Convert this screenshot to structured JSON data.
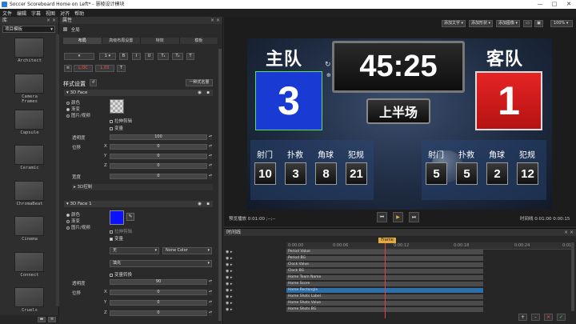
{
  "window": {
    "title": "Soccer Scoreboard Home on Left* - 慧棱设计模块"
  },
  "menu": [
    "文件",
    "编辑",
    "字幕",
    "视图",
    "对齐",
    "帮助"
  ],
  "library": {
    "panel_title": "库",
    "dropdown": "项目模板",
    "items": [
      "Architect",
      "Camera Frames",
      "Capsule",
      "Ceramic",
      "ChromaBeat",
      "Cinema",
      "Connect",
      "Cruels"
    ]
  },
  "properties": {
    "panel_title": "属性",
    "object_name": "全局",
    "tabs": [
      "布局",
      "高级布局设置",
      "特效",
      "模板"
    ],
    "text_tools": [
      "B",
      "I",
      "U",
      "T₁",
      "T₂",
      "T"
    ],
    "color_labels": [
      "L.OC",
      "L.03"
    ],
    "style_title": "样式设置",
    "style_dropdown": "一种式名量",
    "face1": {
      "title": "3D Face",
      "fill_options": [
        "颜色",
        "渐变",
        "图片/视频"
      ],
      "stretch": "拉伸剪辑",
      "vary": "变量",
      "opacity_label": "透明度",
      "opacity_value": "100",
      "pos_label": "位移",
      "x": "0",
      "y": "0",
      "z": "0",
      "width_label": "宽度",
      "width_value": "0",
      "control_3d": "3D控制"
    },
    "face2": {
      "title": "3D Face 1",
      "fill_options": [
        "颜色",
        "渐变",
        "图片/视频"
      ],
      "stretch": "拉伸剪辑",
      "vary": "变量",
      "dd1": "无",
      "dd2": "None Color",
      "dd3": "填充",
      "vary2": "变量转换",
      "opacity_label": "透明度",
      "opacity_value": "90",
      "pos_label": "位移",
      "x": "0",
      "y": "0",
      "z": "0"
    }
  },
  "preview": {
    "toolbar": [
      "添加文字 ▾",
      "添加形状 ▾",
      "添加图像 ▾"
    ],
    "zoom": "100%",
    "left_time_label": "预览播放",
    "left_time": "0:01:00 ;--;--",
    "right_time_label": "时间线",
    "right_time": "0:01:00 0:00:15",
    "controls": [
      "⏮",
      "▶",
      "⏭"
    ]
  },
  "scoreboard": {
    "home_label": "主队",
    "away_label": "客队",
    "home_score": "3",
    "away_score": "1",
    "clock": "45:25",
    "period": "上半场",
    "stat_labels": [
      "射门",
      "扑救",
      "角球",
      "犯规"
    ],
    "home_stats": [
      "10",
      "3",
      "8",
      "21"
    ],
    "away_stats": [
      "5",
      "5",
      "2",
      "12"
    ],
    "home_color": "#1a3ad4",
    "away_color": "#d91c1c"
  },
  "timeline": {
    "panel_title": "时间线",
    "ticks": [
      "0:00:00",
      "0:00:06",
      "0:00:12",
      "0:00:18",
      "0:00:24",
      "0:01"
    ],
    "playhead": "Frame",
    "tracks": [
      "Period Value",
      "Period BG",
      "Clock Value",
      "Clock BG",
      "Home Team Name",
      "Home Score",
      "Home Rectangle",
      "Home Shots Label",
      "Home Shots Value",
      "Home Shots BG"
    ],
    "footer_buttons": [
      "+",
      "-",
      "×",
      "✓"
    ]
  }
}
